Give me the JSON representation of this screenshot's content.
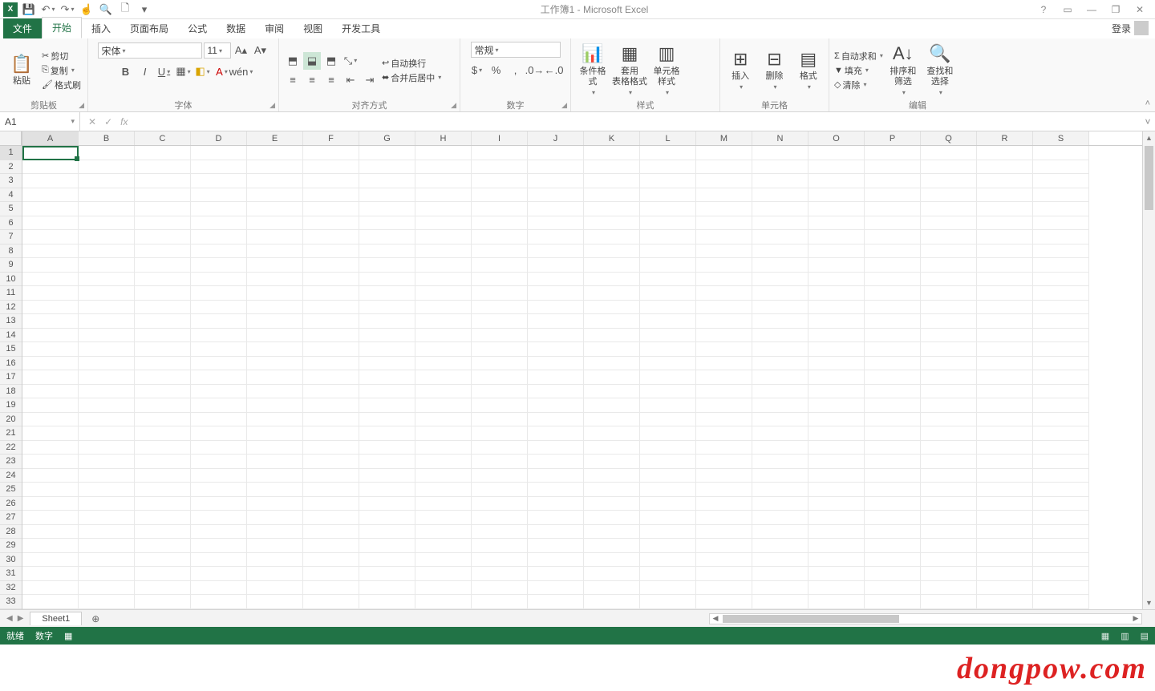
{
  "window": {
    "title": "工作簿1 - Microsoft Excel",
    "help": "?",
    "ribbonOpts": "▭",
    "min": "—",
    "restore": "❐",
    "close": "✕"
  },
  "qat": {
    "app": "X",
    "save": "💾",
    "undo": "↶",
    "redo": "↷",
    "touch": "☝",
    "preview": "🔍",
    "new": "🗋",
    "more": "▾"
  },
  "tabs": {
    "file": "文件",
    "home": "开始",
    "insert": "插入",
    "layout": "页面布局",
    "formulas": "公式",
    "data": "数据",
    "review": "审阅",
    "view": "视图",
    "dev": "开发工具",
    "login": "登录"
  },
  "ribbon": {
    "clip": {
      "paste": "粘贴",
      "cut": "剪切",
      "copy": "复制",
      "brush": "格式刷",
      "label": "剪贴板"
    },
    "font": {
      "name": "宋体",
      "size": "11",
      "bold": "B",
      "italic": "I",
      "underline": "U",
      "label": "字体"
    },
    "align": {
      "wrap": "自动换行",
      "merge": "合并后居中",
      "label": "对齐方式"
    },
    "number": {
      "format": "常规",
      "percent": "%",
      "comma": ",",
      "label": "数字"
    },
    "styles": {
      "cond": "条件格式",
      "table": "套用\n表格格式",
      "cell": "单元格样式",
      "label": "样式"
    },
    "cells": {
      "insert": "插入",
      "delete": "删除",
      "format": "格式",
      "label": "单元格"
    },
    "edit": {
      "sum": "自动求和",
      "fill": "填充",
      "clear": "清除",
      "sort": "排序和筛选",
      "find": "查找和选择",
      "label": "编辑"
    }
  },
  "fx": {
    "cell": "A1",
    "cancel": "✕",
    "enter": "✓",
    "fx": "fx",
    "formula": ""
  },
  "grid": {
    "cols": [
      "A",
      "B",
      "C",
      "D",
      "E",
      "F",
      "G",
      "H",
      "I",
      "J",
      "K",
      "L",
      "M",
      "N",
      "O",
      "P",
      "Q",
      "R",
      "S"
    ],
    "rows": 33
  },
  "sheet": {
    "name": "Sheet1",
    "add": "⊕"
  },
  "status": {
    "ready": "就绪",
    "num": "数字",
    "macro": "▦"
  },
  "watermark": "dongpow.com"
}
